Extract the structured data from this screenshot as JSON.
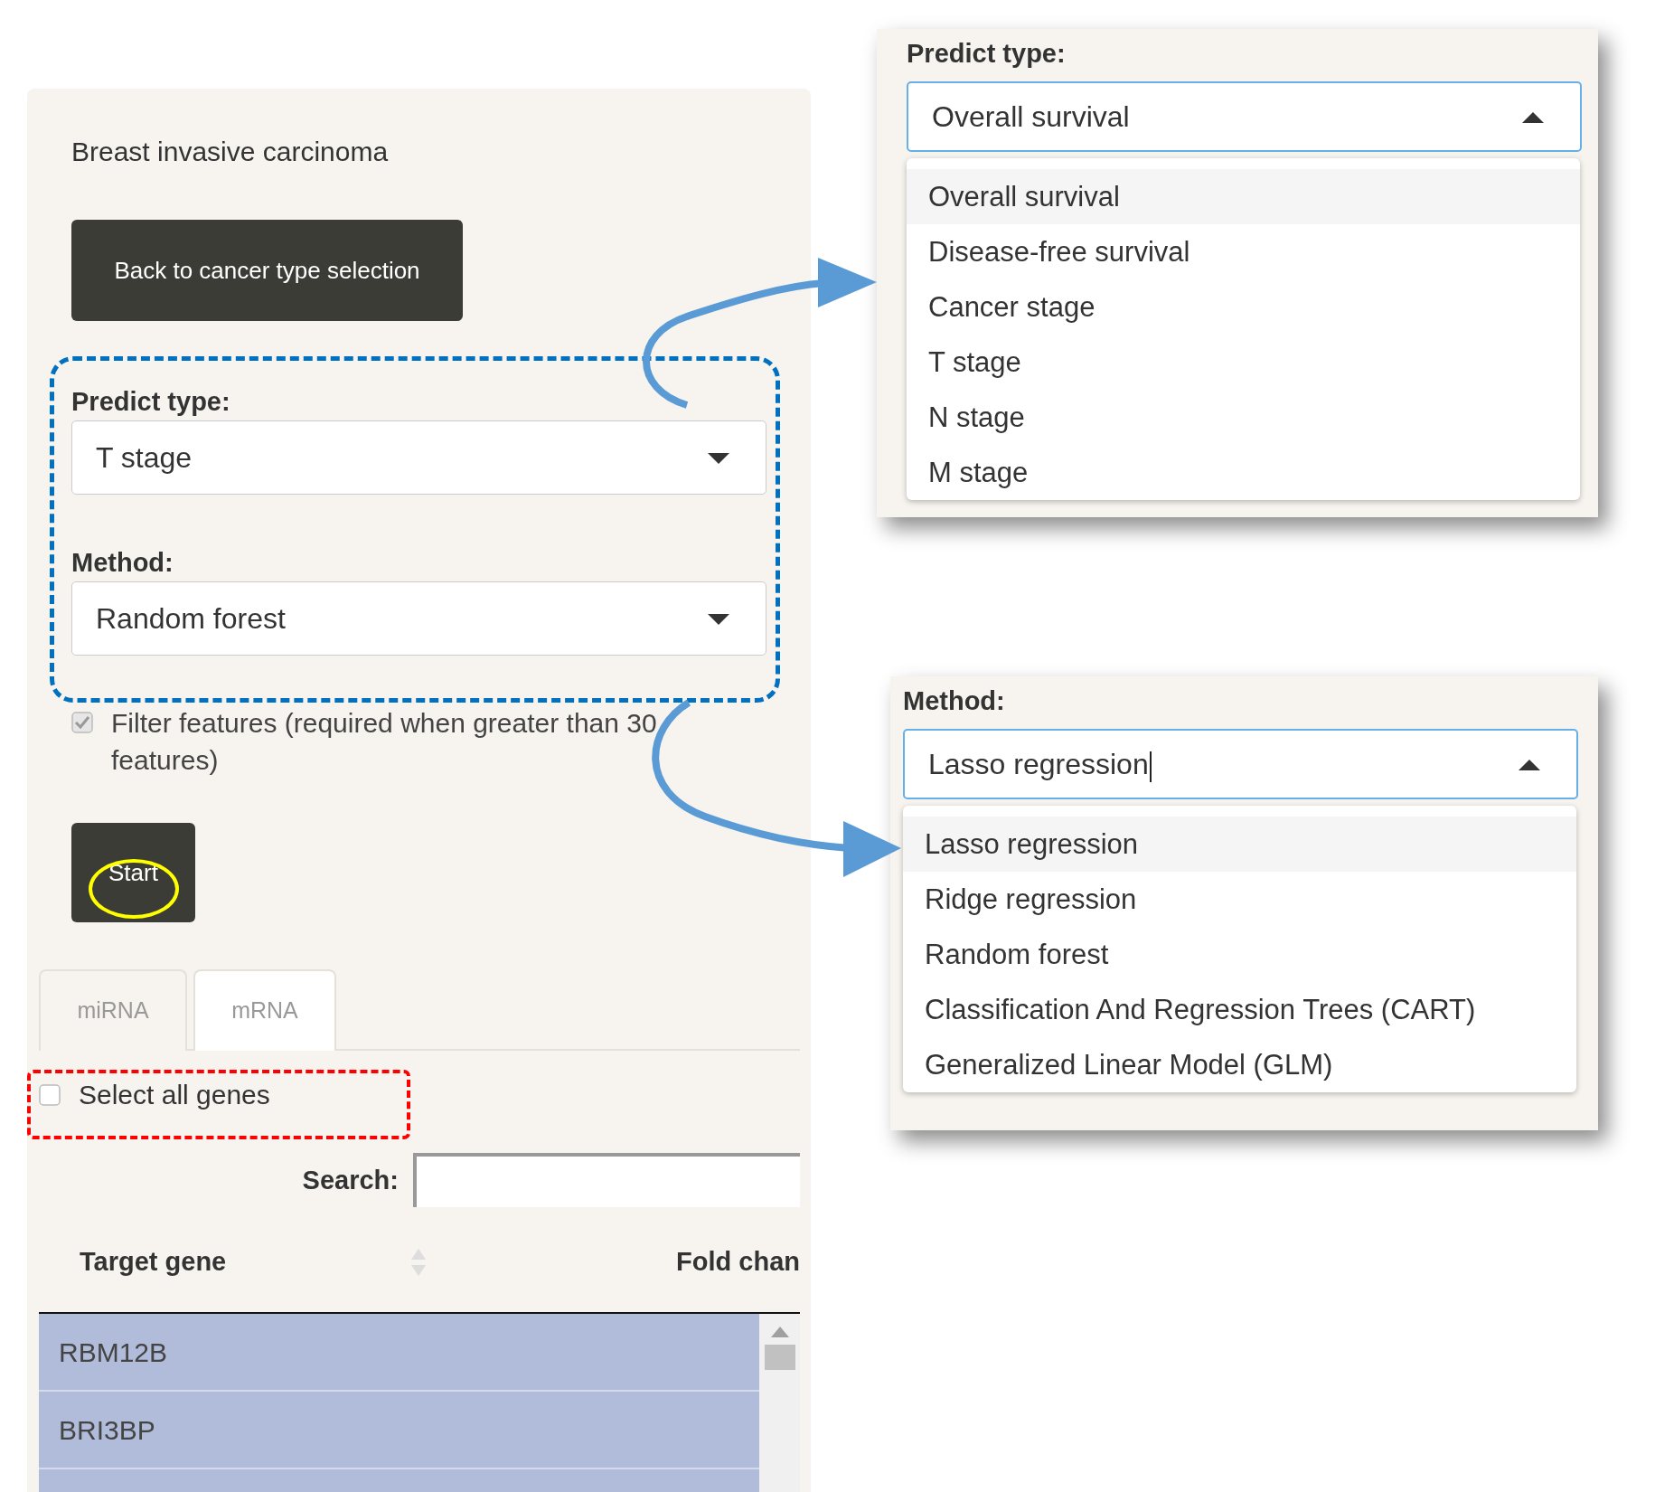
{
  "main_panel": {
    "title": "Breast invasive carcinoma",
    "back_button": "Back to cancer type selection",
    "predict_type": {
      "label": "Predict type:",
      "value": "T stage",
      "open": false
    },
    "method": {
      "label": "Method:",
      "value": "Random forest",
      "open": false
    },
    "filter_features": {
      "label": "Filter features (required when greater than 30 features)",
      "checked": true,
      "disabled": true
    },
    "start_button": "Start",
    "tabs": [
      {
        "label": "miRNA",
        "selected": false
      },
      {
        "label": "mRNA",
        "selected": true
      }
    ],
    "select_all": {
      "label": "Select all genes",
      "checked": false
    },
    "search": {
      "label": "Search:"
    },
    "table": {
      "columns": [
        "Target gene",
        "Fold chan"
      ],
      "rows": [
        {
          "gene": "RBM12B",
          "selected": true
        },
        {
          "gene": "BRI3BP",
          "selected": true
        }
      ]
    }
  },
  "predict_type_dropdown": {
    "label": "Predict type:",
    "value": "Overall survival",
    "open": true,
    "text_cursor": false,
    "options": [
      {
        "label": "Overall survival",
        "selected": true
      },
      {
        "label": "Disease-free survival",
        "selected": false
      },
      {
        "label": "Cancer stage",
        "selected": false
      },
      {
        "label": "T stage",
        "selected": false
      },
      {
        "label": "N stage",
        "selected": false
      },
      {
        "label": "M stage",
        "selected": false
      }
    ]
  },
  "method_dropdown": {
    "label": "Method:",
    "value": "Lasso regression",
    "open": true,
    "text_cursor": true,
    "options": [
      {
        "label": "Lasso regression",
        "selected": true
      },
      {
        "label": "Ridge regression",
        "selected": false
      },
      {
        "label": "Random forest",
        "selected": false
      },
      {
        "label": "Classification And Regression Trees (CART)",
        "selected": false
      },
      {
        "label": "Generalized Linear Model (GLM)",
        "selected": false
      }
    ]
  }
}
